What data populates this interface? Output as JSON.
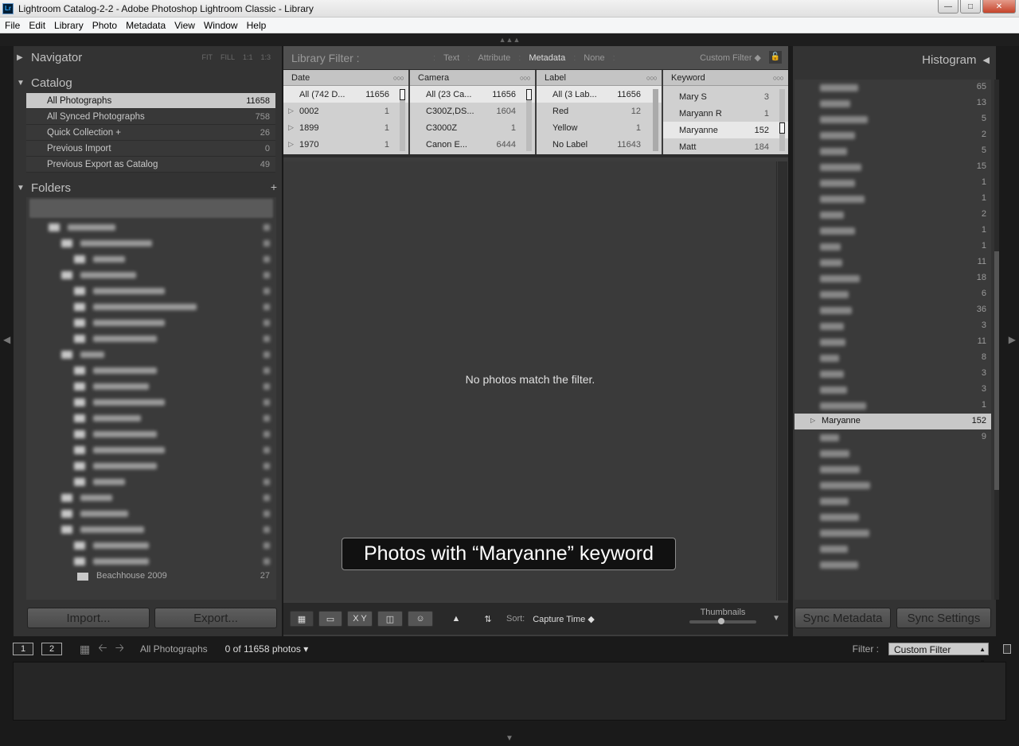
{
  "window": {
    "title": "Lightroom Catalog-2-2 - Adobe Photoshop Lightroom Classic - Library",
    "app_badge": "Lr"
  },
  "menu": [
    "File",
    "Edit",
    "Library",
    "Photo",
    "Metadata",
    "View",
    "Window",
    "Help"
  ],
  "navigator": {
    "title": "Navigator",
    "options": [
      "FIT",
      "FILL",
      "1:1",
      "1:3"
    ]
  },
  "catalog": {
    "title": "Catalog",
    "items": [
      {
        "label": "All Photographs",
        "count": "11658"
      },
      {
        "label": "All Synced Photographs",
        "count": "758"
      },
      {
        "label": "Quick Collection +",
        "count": "26"
      },
      {
        "label": "Previous Import",
        "count": "0"
      },
      {
        "label": "Previous Export as Catalog",
        "count": "49"
      }
    ]
  },
  "folders": {
    "title": "Folders",
    "last_visible": {
      "label": "Beachhouse 2009",
      "count": "27"
    }
  },
  "left_buttons": {
    "import": "Import...",
    "export": "Export..."
  },
  "library_filter": {
    "label": "Library Filter :",
    "options": [
      "Text",
      "Attribute",
      "Metadata",
      "None"
    ],
    "active": "Metadata",
    "preset": "Custom Filter ◆"
  },
  "columns": {
    "date": {
      "header": "Date",
      "rows": [
        {
          "label": "All (742 D...",
          "count": "11656"
        },
        {
          "label": "0002",
          "count": "1"
        },
        {
          "label": "1899",
          "count": "1"
        },
        {
          "label": "1970",
          "count": "1"
        }
      ]
    },
    "camera": {
      "header": "Camera",
      "rows": [
        {
          "label": "All (23 Ca...",
          "count": "11656"
        },
        {
          "label": "C300Z,DS...",
          "count": "1604"
        },
        {
          "label": "C3000Z",
          "count": "1"
        },
        {
          "label": "Canon E...",
          "count": "6444"
        }
      ]
    },
    "label": {
      "header": "Label",
      "rows": [
        {
          "label": "All (3 Lab...",
          "count": "11656"
        },
        {
          "label": "Red",
          "count": "12"
        },
        {
          "label": "Yellow",
          "count": "1"
        },
        {
          "label": "No Label",
          "count": "11643"
        }
      ]
    },
    "keyword": {
      "header": "Keyword",
      "rows": [
        {
          "label": "Mary S",
          "count": "3"
        },
        {
          "label": "Maryann R",
          "count": "1"
        },
        {
          "label": "Maryanne",
          "count": "152"
        },
        {
          "label": "Matt",
          "count": "184"
        }
      ]
    }
  },
  "grid": {
    "empty_message": "No photos match the filter."
  },
  "annotation": "Photos with “Maryanne” keyword",
  "toolbar": {
    "sort_label": "Sort:",
    "sort_value": "Capture Time ◆",
    "thumbnails_label": "Thumbnails",
    "xy_label": "X Y"
  },
  "histogram": {
    "title": "Histogram"
  },
  "keyword_list": {
    "counts": [
      "65",
      "13",
      "5",
      "2",
      "5",
      "15",
      "1",
      "1",
      "2",
      "1",
      "1",
      "11",
      "18",
      "6",
      "36",
      "3",
      "11",
      "8",
      "3",
      "3",
      "1"
    ],
    "selected": {
      "label": "Maryanne",
      "count": "152"
    },
    "after_counts": [
      "9"
    ]
  },
  "right_buttons": {
    "sync_metadata": "Sync Metadata",
    "sync_settings": "Sync Settings"
  },
  "filmstrip": {
    "page1": "1",
    "page2": "2",
    "source": "All Photographs",
    "count": "0 of 11658 photos ▾",
    "filter_label": "Filter :",
    "filter_value": "Custom Filter"
  },
  "colors": {
    "panel": "#333333",
    "selection": "#c8c8c8",
    "background": "#1a1a1a"
  }
}
